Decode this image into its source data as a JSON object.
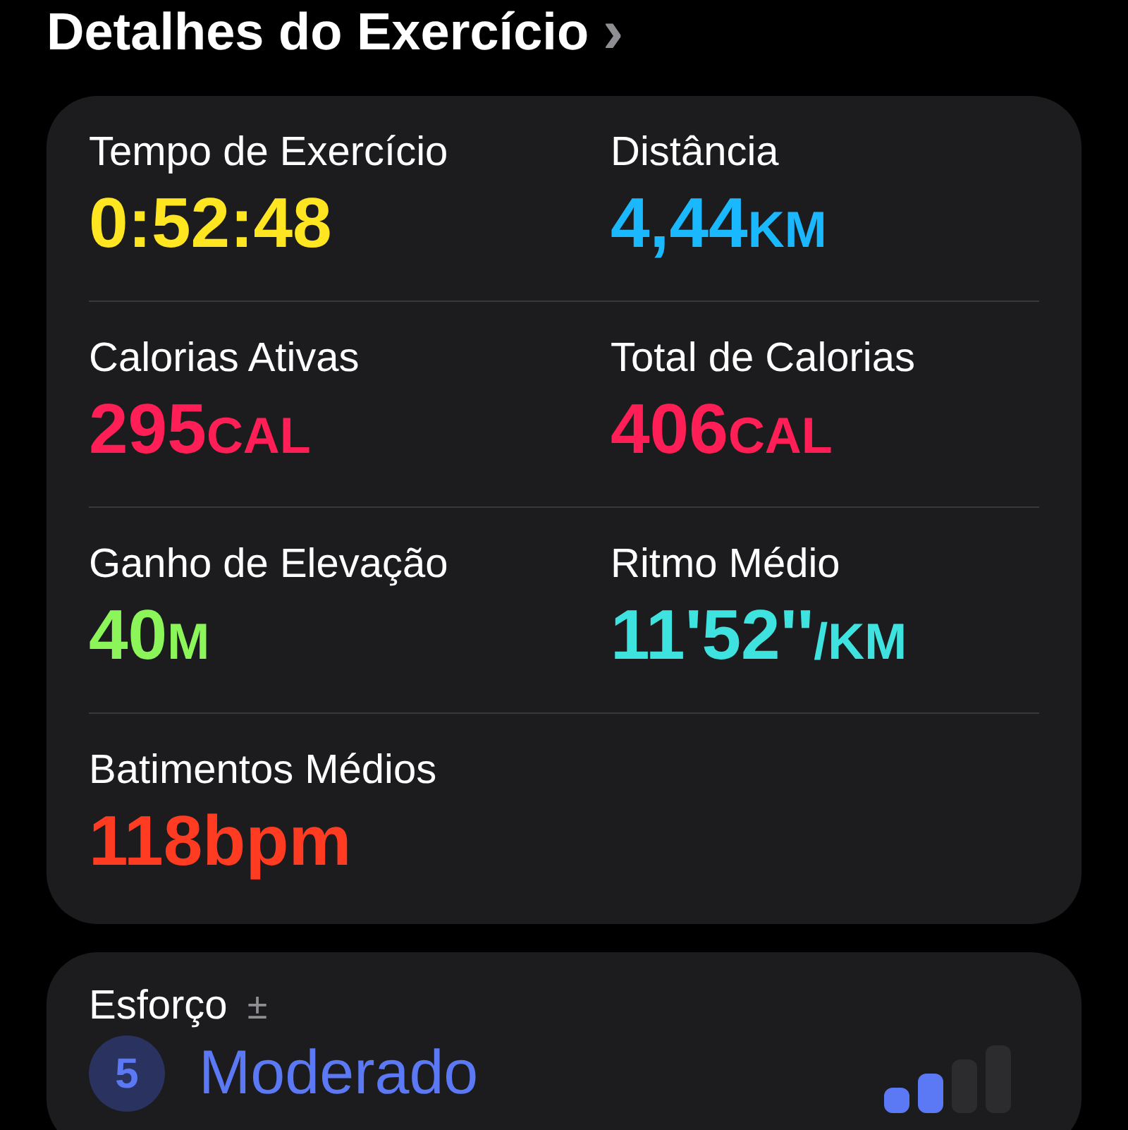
{
  "header": {
    "title": "Detalhes do Exercício",
    "chevron": "›"
  },
  "metrics": [
    {
      "label": "Tempo de Exercício",
      "value": "0:52:48",
      "color": "#ffe620"
    },
    {
      "label": "Distância",
      "value": "4,44",
      "unit": "KM",
      "color": "#1ab8ff"
    },
    {
      "label": "Calorias Ativas",
      "value": "295",
      "unit": "CAL",
      "color": "#ff1e55"
    },
    {
      "label": "Total de Calorias",
      "value": "406",
      "unit": "CAL",
      "color": "#ff1e55"
    },
    {
      "label": "Ganho de Elevação",
      "value": "40",
      "unit": "M",
      "color": "#8cf55a"
    },
    {
      "label": "Ritmo Médio",
      "value": "11'52''",
      "unit": "/KM",
      "color": "#3ee3e0"
    },
    {
      "label": "Batimentos Médios",
      "value": "118bpm",
      "color": "#ff3b22"
    }
  ],
  "effort": {
    "label": "Esforço",
    "adjust": "±",
    "score": "5",
    "rating": "Moderado",
    "level": 0.5
  }
}
